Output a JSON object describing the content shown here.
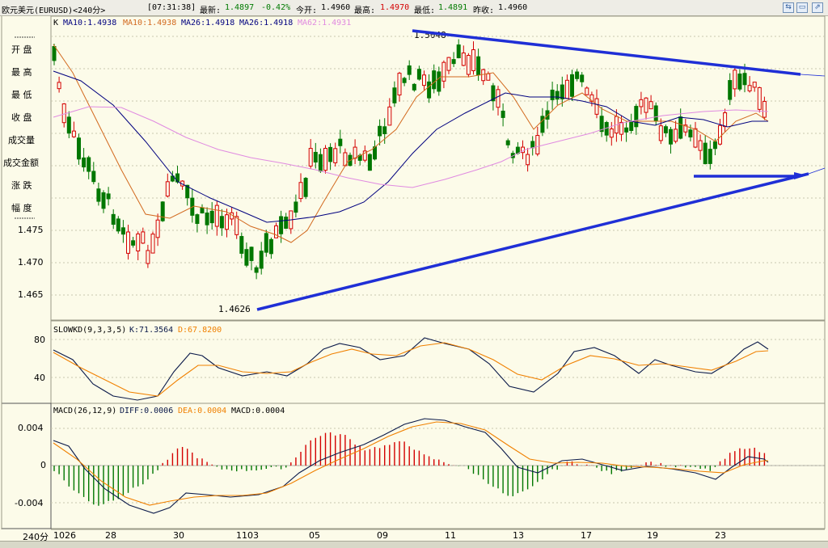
{
  "window": {
    "instrument": "欧元美元(EURUSD)<240分>",
    "time": "[07:31:38]",
    "latest_label": "最新:",
    "latest": "1.4897",
    "change": "-0.42%",
    "open_label": "今开:",
    "open": "1.4960",
    "high_label": "最高:",
    "high": "1.4970",
    "low_label": "最低:",
    "low": "1.4891",
    "prev_label": "昨收:",
    "prev": "1.4960"
  },
  "left_panel": {
    "labels": [
      "开 盘",
      "最 高",
      "最 低",
      "收 盘",
      "成交量",
      "成交金额",
      "涨 跌",
      "幅 度"
    ],
    "bottom_label": "240分"
  },
  "price_chart": {
    "header": {
      "k": "K",
      "ma10a": "MA10:1.4938",
      "ma10b": "MA10:1.4938",
      "ma26a": "MA26:1.4918",
      "ma26b": "MA26:1.4918",
      "ma62": "MA62:1.4931"
    },
    "y_ticks": [
      "1.475",
      "1.470",
      "1.465"
    ],
    "annotation_high": "1.5048",
    "annotation_low": "1.4626"
  },
  "kd_panel": {
    "header": {
      "name": "SLOWKD(9,3,3,5)",
      "k": "K:71.3564",
      "d": "D:67.8200"
    },
    "y_ticks": [
      "80",
      "40"
    ]
  },
  "macd_panel": {
    "header": {
      "name": "MACD(26,12,9)",
      "diff": "DIFF:0.0006",
      "dea": "DEA:0.0004",
      "macd": "MACD:0.0004"
    },
    "y_ticks": [
      "0.004",
      "0",
      "-0.004"
    ]
  },
  "x_axis": {
    "labels": [
      "1026",
      "28",
      "30",
      "1103",
      "05",
      "09",
      "11",
      "13",
      "17",
      "19",
      "23"
    ]
  },
  "colors": {
    "up": "#d40000",
    "down": "#007700",
    "trendline": "#1f2fd6",
    "ma10": "#d2691e",
    "ma26": "#00007f",
    "ma62": "#e08ae0",
    "kd_k": "#0b1a4a",
    "kd_d": "#f08000"
  },
  "chart_data": {
    "type": "candlestick",
    "timeframe": "240分",
    "x_labels": [
      "1026",
      "28",
      "30",
      "1103",
      "05",
      "09",
      "11",
      "13",
      "17",
      "19",
      "23"
    ],
    "price_high_marker": 1.5048,
    "price_low_marker": 1.4626,
    "current": {
      "latest": 1.4897,
      "open": 1.496,
      "high": 1.497,
      "low": 1.4891,
      "prev_close": 1.496,
      "change_pct": -0.42
    },
    "indicators": {
      "MA10": 1.4938,
      "MA26": 1.4918,
      "MA62": 1.4931,
      "SLOWKD_K": 71.3564,
      "SLOWKD_D": 67.82,
      "MACD_DIFF": 0.0006,
      "MACD_DEA": 0.0004,
      "MACD": 0.0004
    },
    "price_axis_ticks": [
      1.475,
      1.47,
      1.465
    ],
    "kd_axis_ticks": [
      80,
      40
    ],
    "macd_axis_ticks": [
      0.004,
      0,
      -0.004
    ]
  }
}
